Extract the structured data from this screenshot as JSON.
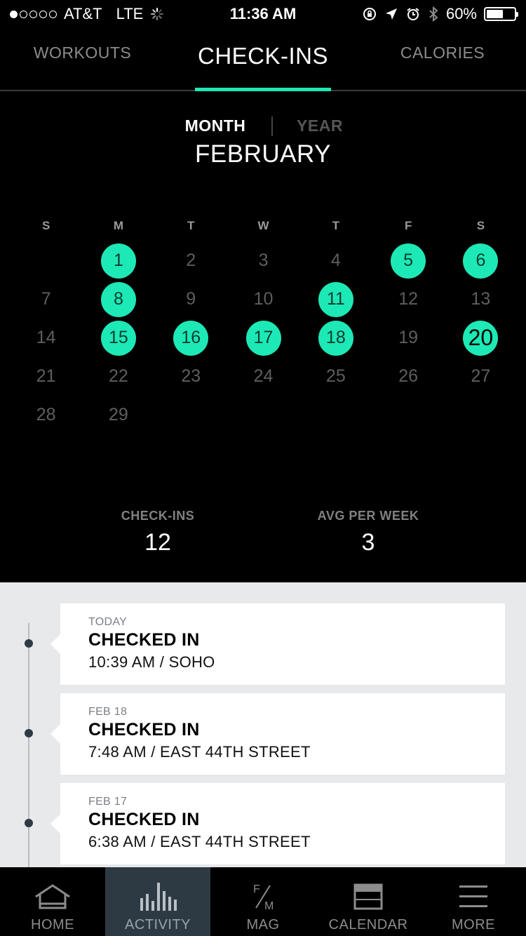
{
  "status_bar": {
    "carrier": "AT&T",
    "network": "LTE",
    "time": "11:36 AM",
    "battery": "60%",
    "battery_level": 0.6,
    "signal_bars": 1
  },
  "tabs": {
    "workouts": "WORKOUTS",
    "checkins": "CHECK-INS",
    "calories": "CALORIES",
    "active": "checkins"
  },
  "range": {
    "month": "MONTH",
    "year": "YEAR",
    "selected": "month"
  },
  "calendar": {
    "month_title": "FEBRUARY",
    "weekdays": [
      "S",
      "M",
      "T",
      "W",
      "T",
      "F",
      "S"
    ],
    "first_weekday_offset": 1,
    "days_in_month": 29,
    "checkin_days": [
      1,
      5,
      6,
      8,
      11,
      15,
      16,
      17,
      18
    ],
    "today": 20,
    "accent_color": "#1de9b6"
  },
  "stats": {
    "checkins_label": "CHECK-INS",
    "checkins_value": "12",
    "avg_label": "AVG PER WEEK",
    "avg_value": "3"
  },
  "feed": [
    {
      "date": "TODAY",
      "title": "CHECKED IN",
      "detail": "10:39 AM / SOHO"
    },
    {
      "date": "FEB 18",
      "title": "CHECKED IN",
      "detail": "7:48 AM / EAST 44TH STREET"
    },
    {
      "date": "FEB 17",
      "title": "CHECKED IN",
      "detail": "6:38 AM / EAST 44TH STREET"
    }
  ],
  "nav": [
    {
      "label": "HOME",
      "icon": "home-icon"
    },
    {
      "label": "ACTIVITY",
      "icon": "activity-bars-icon",
      "active": true
    },
    {
      "label": "MAG",
      "icon": "fm-mag-icon",
      "icon_top": "F",
      "icon_bottom": "M"
    },
    {
      "label": "CALENDAR",
      "icon": "calendar-icon"
    },
    {
      "label": "MORE",
      "icon": "menu-icon"
    }
  ]
}
